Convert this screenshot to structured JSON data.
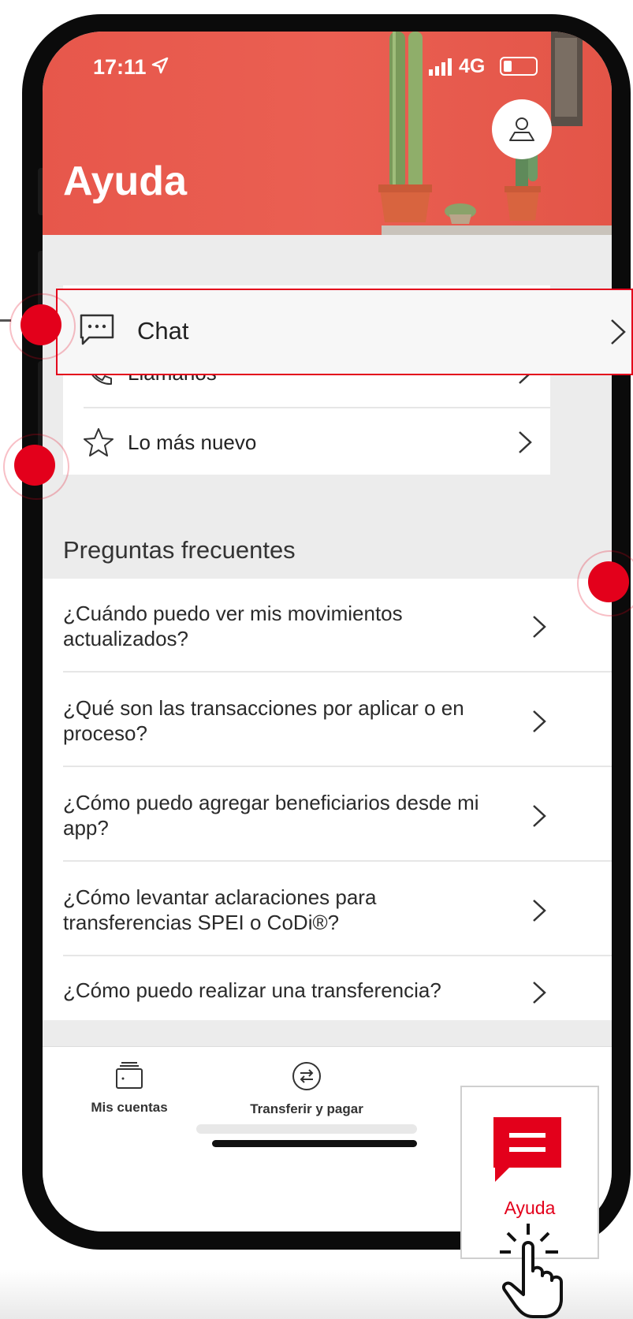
{
  "status_bar": {
    "time": "17:11",
    "network": "4G"
  },
  "header": {
    "title": "Ayuda",
    "profile_icon": "user-icon"
  },
  "contact": {
    "items": [
      {
        "label": "Chat",
        "icon": "chat-icon"
      },
      {
        "label": "Llámanos",
        "icon": "phone-icon"
      },
      {
        "label": "Lo más nuevo",
        "icon": "star-icon"
      }
    ]
  },
  "faq": {
    "title": "Preguntas frecuentes",
    "items": [
      {
        "question": "¿Cuándo puedo ver mis movimientos actualizados?"
      },
      {
        "question": "¿Qué son las transacciones por aplicar o en proceso?"
      },
      {
        "question": "¿Cómo puedo agregar beneficiarios desde mi app?"
      },
      {
        "question": "¿Cómo levantar aclaraciones para transferencias SPEI o CoDi®?"
      },
      {
        "question": "¿Cómo puedo realizar una transferencia?"
      }
    ]
  },
  "tabbar": {
    "items": [
      {
        "label": "Mis cuentas",
        "icon": "wallet-icon"
      },
      {
        "label": "Transferir y pagar",
        "icon": "transfer-icon"
      },
      {
        "label": "Ayuda",
        "icon": "chat-bubble-icon",
        "active": true
      }
    ]
  },
  "colors": {
    "accent": "#e3001b",
    "header_bg": "#e85a4f",
    "background": "#ececec"
  }
}
